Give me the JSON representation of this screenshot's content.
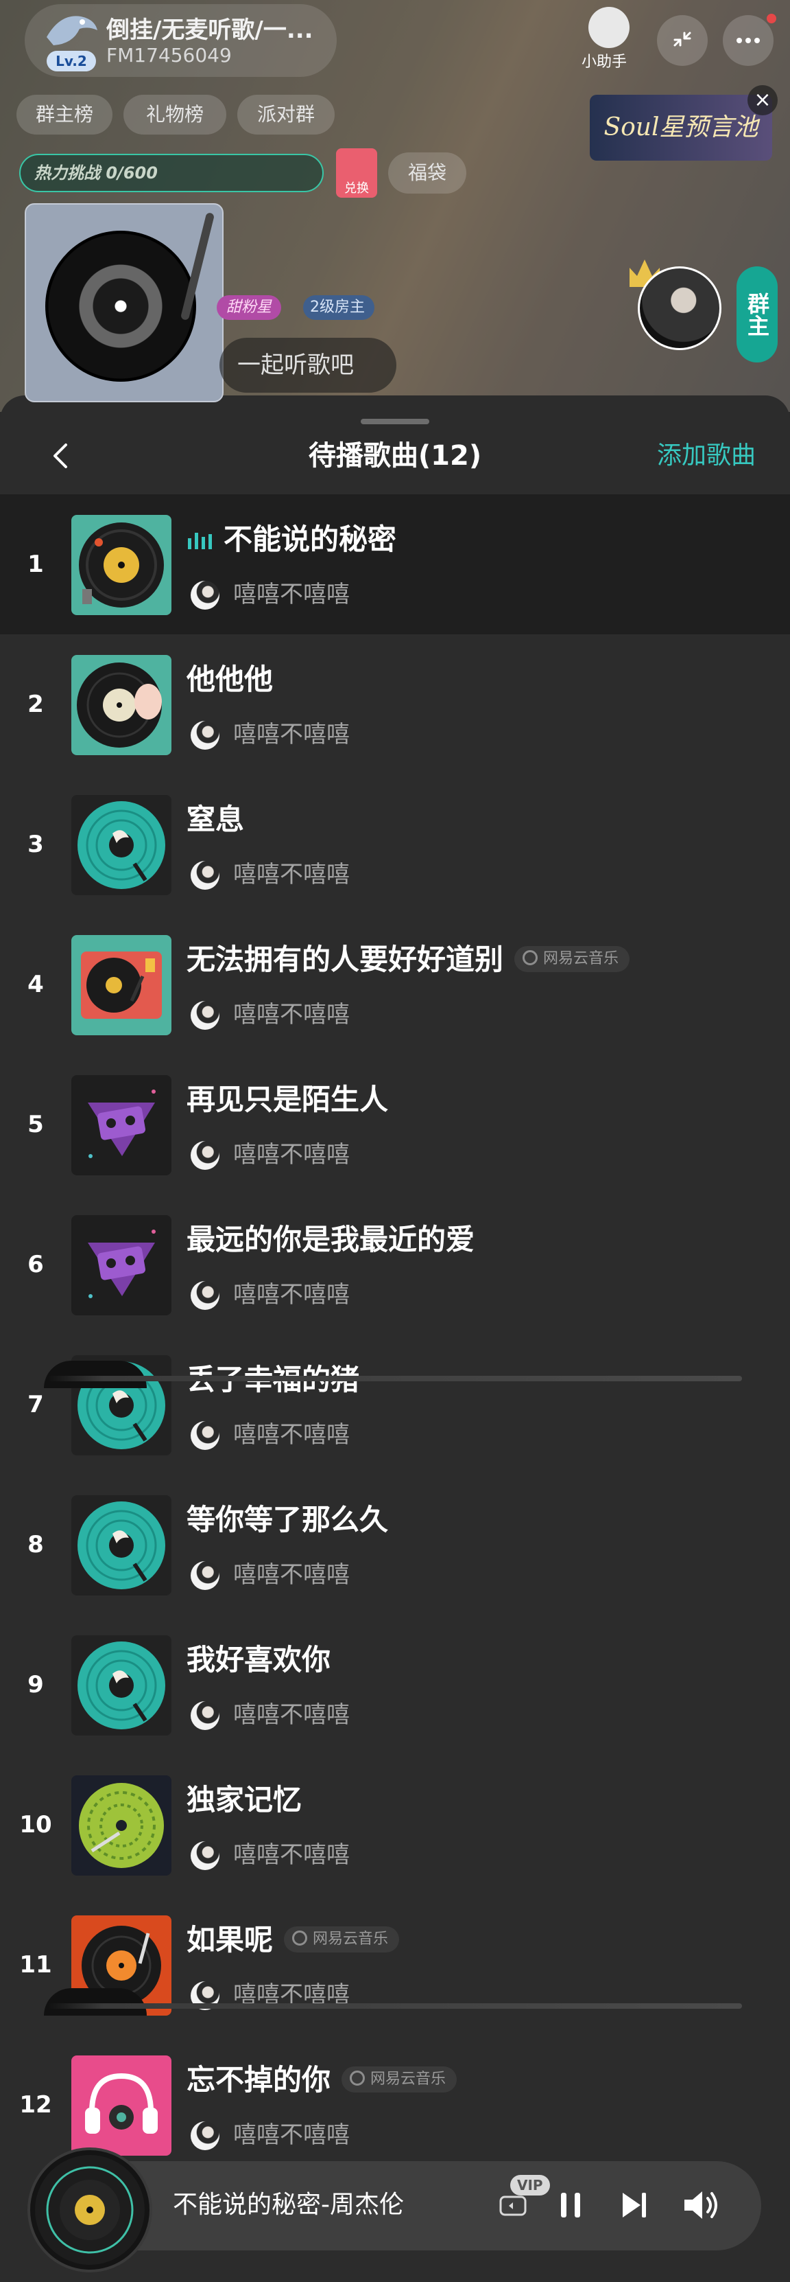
{
  "room": {
    "title": "倒挂/无麦听歌/一...",
    "room_id": "FM17456049",
    "level": "Lv.2",
    "assistant_label": "小助手",
    "tabs": [
      "群主榜",
      "礼物榜",
      "派对群"
    ],
    "banner_text": "Soul星预言池",
    "challenge": "热力挑战 0/600",
    "exchange_label": "兑换",
    "lucky_bag": "福袋",
    "sweet_badge": "甜粉星",
    "owner_badge": "2级房主",
    "listen_prompt": "一起听歌吧",
    "group_badge": "群主"
  },
  "sheet": {
    "title": "待播歌曲(12)",
    "add_song": "添加歌曲"
  },
  "songs": [
    {
      "index": "1",
      "title": "不能说的秘密",
      "user": "嘻嘻不嘻嘻",
      "source": "",
      "cover": "vinyl-yellow"
    },
    {
      "index": "2",
      "title": "他他他",
      "user": "嘻嘻不嘻嘻",
      "source": "",
      "cover": "vinyl-hand"
    },
    {
      "index": "3",
      "title": "窒息",
      "user": "嘻嘻不嘻嘻",
      "source": "",
      "cover": "vinyl-teal"
    },
    {
      "index": "4",
      "title": "无法拥有的人要好好道别",
      "user": "嘻嘻不嘻嘻",
      "source": "网易云音乐",
      "cover": "turntable-red"
    },
    {
      "index": "5",
      "title": "再见只是陌生人",
      "user": "嘻嘻不嘻嘻",
      "source": "",
      "cover": "cassette-purple"
    },
    {
      "index": "6",
      "title": "最远的你是我最近的爱",
      "user": "嘻嘻不嘻嘻",
      "source": "",
      "cover": "cassette-purple"
    },
    {
      "index": "7",
      "title": "丢了幸福的猪",
      "user": "嘻嘻不嘻嘻",
      "source": "",
      "cover": "vinyl-teal"
    },
    {
      "index": "8",
      "title": "等你等了那么久",
      "user": "嘻嘻不嘻嘻",
      "source": "",
      "cover": "vinyl-teal"
    },
    {
      "index": "9",
      "title": "我好喜欢你",
      "user": "嘻嘻不嘻嘻",
      "source": "",
      "cover": "vinyl-teal"
    },
    {
      "index": "10",
      "title": "独家记忆",
      "user": "嘻嘻不嘻嘻",
      "source": "",
      "cover": "vinyl-green"
    },
    {
      "index": "11",
      "title": "如果呢",
      "user": "嘻嘻不嘻嘻",
      "source": "网易云音乐",
      "cover": "vinyl-orange"
    },
    {
      "index": "12",
      "title": "忘不掉的你",
      "user": "嘻嘻不嘻嘻",
      "source": "网易云音乐",
      "cover": "headphones-pink"
    }
  ],
  "player": {
    "now_playing": "不能说的秘密-周杰伦",
    "vip_label": "VIP"
  },
  "colors": {
    "accent": "#37c8c0",
    "sheet_bg": "#2c2c2c",
    "active_row": "#1f1f1f"
  }
}
